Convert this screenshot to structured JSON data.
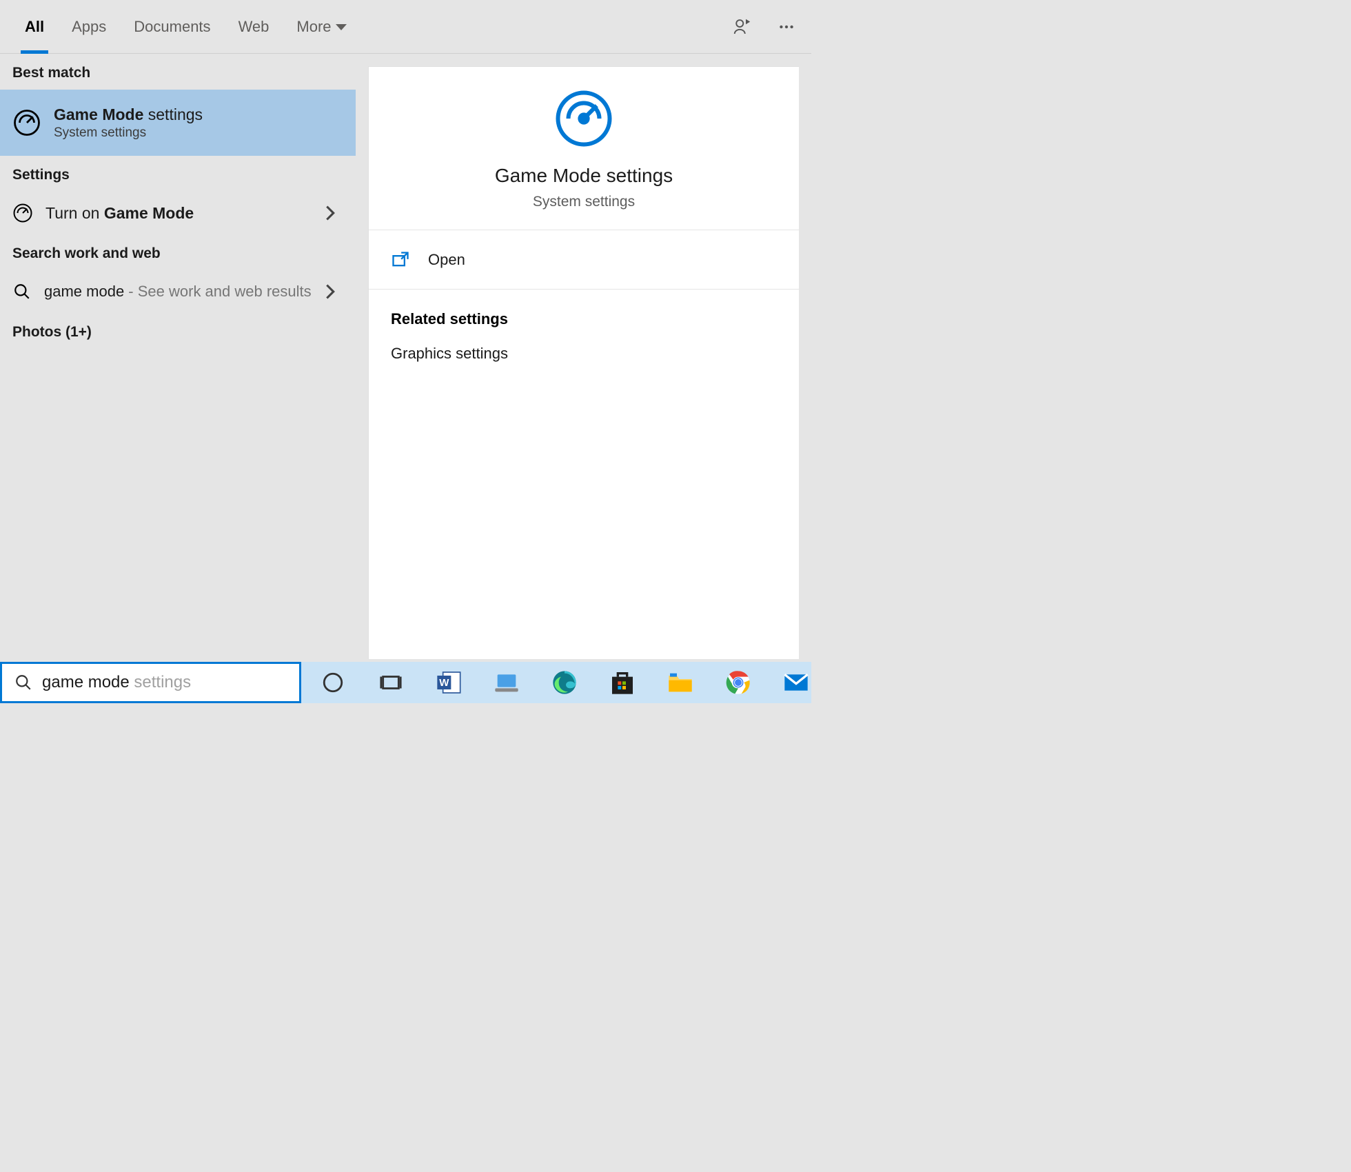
{
  "tabs": {
    "items": [
      "All",
      "Apps",
      "Documents",
      "Web",
      "More"
    ],
    "active_index": 0
  },
  "sections": {
    "best_match": "Best match",
    "settings": "Settings",
    "search_work_web": "Search work and web",
    "photos": "Photos (1+)"
  },
  "best_match_item": {
    "title_bold": "Game Mode",
    "title_rest": " settings",
    "subtitle": "System settings"
  },
  "settings_item": {
    "prefix": "Turn on ",
    "bold": "Game Mode"
  },
  "web_item": {
    "query": "game mode",
    "hint": " - See work and web results"
  },
  "preview": {
    "title": "Game Mode settings",
    "subtitle": "System settings",
    "open_label": "Open",
    "related_header": "Related settings",
    "related_items": [
      "Graphics settings"
    ]
  },
  "search": {
    "typed": "game mode",
    "ghost": " settings"
  },
  "taskbar_icons": [
    "cortana",
    "task-view",
    "word",
    "laptop",
    "edge",
    "store",
    "explorer",
    "chrome",
    "mail"
  ]
}
